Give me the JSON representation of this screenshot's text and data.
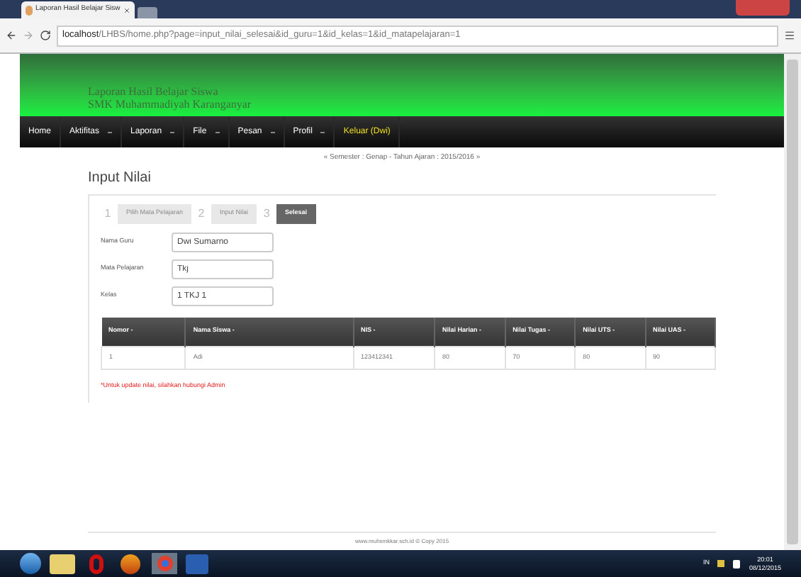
{
  "browser": {
    "tab_title": "Laporan Hasil Belajar Sisw",
    "url_host": "localhost",
    "url_path": "/LHBS/home.php?page=input_nilai_selesai&id_guru=1&id_kelas=1&id_matapelajaran=1"
  },
  "header": {
    "title": "Laporan Hasil Belajar Siswa",
    "subtitle": "SMK Muhammadiyah Karanganyar"
  },
  "nav": [
    {
      "label": "Home",
      "dropdown": false,
      "kind": "normal"
    },
    {
      "label": "Aktifitas",
      "dropdown": true,
      "kind": "normal"
    },
    {
      "label": "Laporan",
      "dropdown": true,
      "kind": "normal"
    },
    {
      "label": "File",
      "dropdown": true,
      "kind": "normal"
    },
    {
      "label": "Pesan",
      "dropdown": true,
      "kind": "normal"
    },
    {
      "label": "Profil",
      "dropdown": true,
      "kind": "normal"
    },
    {
      "label": "Keluar (Dwi)",
      "dropdown": false,
      "kind": "logout"
    }
  ],
  "semester": "« Semester : Genap - Tahun Ajaran : 2015/2016 »",
  "page_title": "Input Nilai",
  "steps": [
    {
      "number": "1",
      "label": "Pilih Mata Pelajaran",
      "selected": false
    },
    {
      "number": "2",
      "label": "Input Nilai",
      "selected": false
    },
    {
      "number": "3",
      "label": "Selesai",
      "selected": true
    }
  ],
  "fields": [
    {
      "label": "Nama Guru",
      "value": "Dwi Sumarno"
    },
    {
      "label": "Mata Pelajaran",
      "value": "Tkj"
    },
    {
      "label": "Kelas",
      "value": "1 TKJ 1"
    }
  ],
  "table": {
    "columns": [
      "Nomor -",
      "Nama Siswa -",
      "NIS -",
      "Nilai Harian -",
      "Nilai Tugas -",
      "Nilai UTS -",
      "Nilai UAS -"
    ],
    "rows": [
      [
        "1",
        "Adi",
        "123412341",
        "80",
        "70",
        "80",
        "90"
      ]
    ]
  },
  "note": "*Untuk update nilai, silahkan hubungi Admin",
  "footer": "www.muhsmkkar.sch.id © Copy 2015",
  "taskbar": {
    "language": "IN",
    "time": "20:01",
    "date": "08/12/2015"
  }
}
